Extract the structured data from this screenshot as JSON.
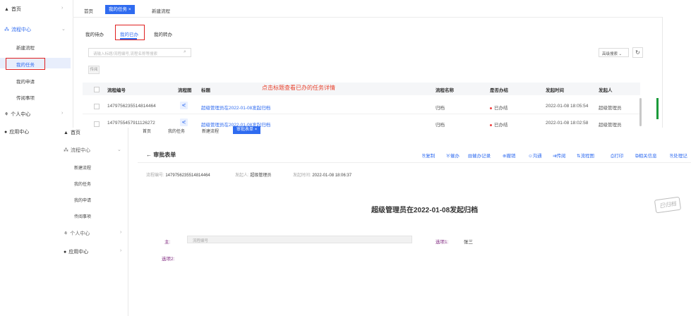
{
  "sidebar1": {
    "items": [
      {
        "icon": "home-icon",
        "label": "首页"
      },
      {
        "icon": "flow-icon",
        "label": "流程中心"
      },
      {
        "icon": "user-icon",
        "label": "个人中心"
      },
      {
        "icon": "app-icon",
        "label": "应用中心"
      }
    ],
    "sub": [
      "新建流程",
      "我的任务",
      "我的申请",
      "传阅事项"
    ]
  },
  "tabs1": [
    "首页",
    "我的任务",
    "新建流程"
  ],
  "subtabs": [
    "我的待办",
    "我的已办",
    "我的转办"
  ],
  "search": {
    "placeholder": "请输入标题/流程编号,流程名称等搜索",
    "advanced": "高级搜索",
    "reset": "",
    "batch": "传阅"
  },
  "table": {
    "headers": [
      "流程编号",
      "流程图",
      "标题",
      "流程名称",
      "是否办结",
      "发起时间",
      "发起人"
    ],
    "annotation": "点击标题查看已办的任务详情",
    "rows": [
      {
        "id": "1479756235514814464",
        "title": "超级管理员在2022-01-08发起归档",
        "flow": "归档",
        "status": "已办结",
        "time": "2022-01-08 18:05:54",
        "user": "超级管理员"
      },
      {
        "id": "1479755457911126272",
        "title": "超级管理员在2022-01-08发起归档",
        "flow": "归档",
        "status": "已办结",
        "time": "2022-01-08 18:02:58",
        "user": "超级管理员"
      }
    ]
  },
  "sidebar2": {
    "items": [
      {
        "icon": "home-icon",
        "label": "首页"
      },
      {
        "icon": "flow-icon",
        "label": "流程中心"
      },
      {
        "icon": "user-icon",
        "label": "个人中心"
      },
      {
        "icon": "app-icon",
        "label": "应用中心"
      }
    ],
    "sub": [
      "新建流程",
      "我的任务",
      "我的申请",
      "传阅事项"
    ]
  },
  "tabs2": [
    "首页",
    "我的任务",
    "新建流程",
    "审批表单"
  ],
  "form": {
    "back": "← 审批表单",
    "toolbar": [
      "复制",
      "催办",
      "催办记录",
      "撤销",
      "沟通",
      "传阅",
      "流程图",
      "打印",
      "相关信息",
      "处理记"
    ],
    "meta": {
      "id_label": "流程编号:",
      "id": "1479756235514814464",
      "starter_label": "发起人:",
      "starter": "超级管理员",
      "time_label": "发起时间:",
      "time": "2022-01-08 18:06:37"
    },
    "title": "超级管理员在2022-01-08发起归档",
    "stamp": "已归档",
    "fields": {
      "main_label": "主:",
      "main_value": "流程编号",
      "opt1_label": "选项1:",
      "opt1_value": "张三",
      "opt2_label": "选项2:"
    }
  }
}
